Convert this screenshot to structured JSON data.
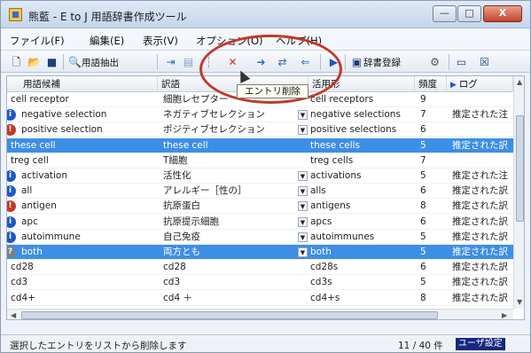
{
  "window": {
    "title": "熊藍 - E to J 用語辞書作成ツール",
    "min": "—",
    "max": "□",
    "close": "X"
  },
  "menu": [
    {
      "label": "ファイル(F)"
    },
    {
      "label": "編集(E)"
    },
    {
      "label": "表示(V)"
    },
    {
      "label": "オプション(O)"
    },
    {
      "label": "ヘルプ(H)"
    }
  ],
  "toolbar": {
    "extract_label": "用語抽出",
    "register_label": "辞書登録",
    "tooltip": "エントリ削除"
  },
  "columns": [
    "用語候補",
    "訳語",
    "活用形",
    "頻度",
    "ログ"
  ],
  "rows": [
    {
      "term": "cell receptor",
      "trans": "細胞レセプター",
      "form": "cell receptors",
      "freq": "9",
      "log": "",
      "badge": "",
      "dd": false,
      "selected": false
    },
    {
      "term": "negative selection",
      "trans": "ネガティブセレクション",
      "form": "negative selections",
      "freq": "7",
      "log": "推定された注",
      "badge": "blue",
      "dd": true,
      "selected": false
    },
    {
      "term": "positive selection",
      "trans": "ポジティブセレクション",
      "form": "positive selections",
      "freq": "6",
      "log": "",
      "badge": "red",
      "dd": true,
      "selected": false
    },
    {
      "term": "these cell",
      "trans": "these cell",
      "form": "these cells",
      "freq": "5",
      "log": "推定された訳",
      "badge": "",
      "dd": false,
      "selected": true
    },
    {
      "term": "treg cell",
      "trans": "T細胞",
      "form": "treg cells",
      "freq": "7",
      "log": "",
      "badge": "",
      "dd": false,
      "selected": false
    },
    {
      "term": "activation",
      "trans": "活性化",
      "form": "activations",
      "freq": "5",
      "log": "推定された注",
      "badge": "blue",
      "dd": true,
      "selected": false
    },
    {
      "term": "all",
      "trans": "アレルギー［性の］",
      "form": "alls",
      "freq": "6",
      "log": "推定された訳",
      "badge": "blue",
      "dd": true,
      "selected": false
    },
    {
      "term": "antigen",
      "trans": "抗原蛋白",
      "form": "antigens",
      "freq": "8",
      "log": "推定された訳",
      "badge": "red",
      "dd": true,
      "selected": false
    },
    {
      "term": "apc",
      "trans": "抗原提示細胞",
      "form": "apcs",
      "freq": "6",
      "log": "推定された訳",
      "badge": "blue",
      "dd": true,
      "selected": false
    },
    {
      "term": "autoimmune",
      "trans": "自己免疫",
      "form": "autoimmunes",
      "freq": "5",
      "log": "推定された訳",
      "badge": "blue",
      "dd": true,
      "selected": false
    },
    {
      "term": "both",
      "trans": "両方とも",
      "form": "both",
      "freq": "5",
      "log": "推定された訳",
      "badge": "gray",
      "dd": true,
      "selected": true
    },
    {
      "term": "cd28",
      "trans": "cd28",
      "form": "cd28s",
      "freq": "6",
      "log": "推定された訳",
      "badge": "",
      "dd": false,
      "selected": false
    },
    {
      "term": "cd3",
      "trans": "cd3",
      "form": "cd3s",
      "freq": "5",
      "log": "推定された訳",
      "badge": "",
      "dd": false,
      "selected": false
    },
    {
      "term": "cd4+",
      "trans": "cd4 ＋",
      "form": "cd4+s",
      "freq": "8",
      "log": "推定された訳",
      "badge": "",
      "dd": false,
      "selected": false
    }
  ],
  "status": {
    "text": "選択したエントリをリストから削除します",
    "count": "11 / 40 件",
    "user": "ユーザ設定"
  },
  "colors": {
    "selection": "#3d8ee6",
    "annotation": "#c0392b",
    "info_badge": "#1f57c8",
    "warn_badge": "#c0392b"
  }
}
